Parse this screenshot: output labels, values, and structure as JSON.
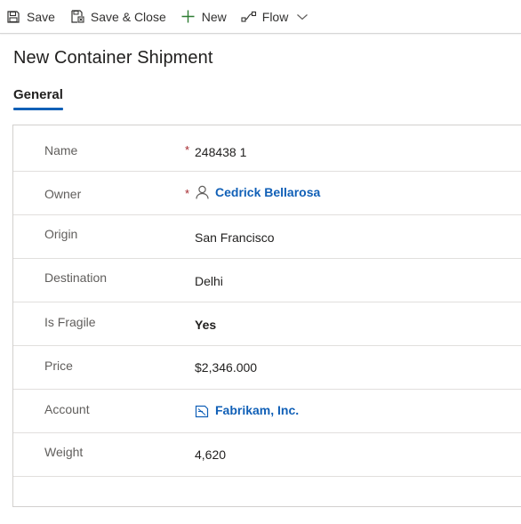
{
  "toolbar": {
    "save_label": "Save",
    "save_close_label": "Save & Close",
    "new_label": "New",
    "flow_label": "Flow",
    "icons": [
      "save-icon",
      "save-close-icon",
      "plus-icon",
      "flow-icon",
      "chevron-down-icon"
    ]
  },
  "form": {
    "title": "New Container Shipment",
    "tabs": [
      {
        "label": "General",
        "selected": true
      }
    ]
  },
  "fields": [
    {
      "label": "Name",
      "required": "*",
      "value": "248438 1"
    },
    {
      "label": "Owner",
      "required": "*",
      "value": "Cedrick Bellarosa",
      "icon": "user-icon"
    },
    {
      "label": "Origin",
      "value": "San Francisco"
    },
    {
      "label": "Destination",
      "value": "Delhi"
    },
    {
      "label": "Is Fragile",
      "value": "Yes"
    },
    {
      "label": "Price",
      "value": "$2,346.000"
    },
    {
      "label": "Account",
      "value": "Fabrikam, Inc.",
      "icon": "account-icon"
    },
    {
      "label": "Weight",
      "value": "4,620"
    }
  ],
  "colors": {
    "accent": "#1160b7",
    "required": "#a4262c",
    "label": "#605e5c",
    "border": "#d2d0ce"
  }
}
